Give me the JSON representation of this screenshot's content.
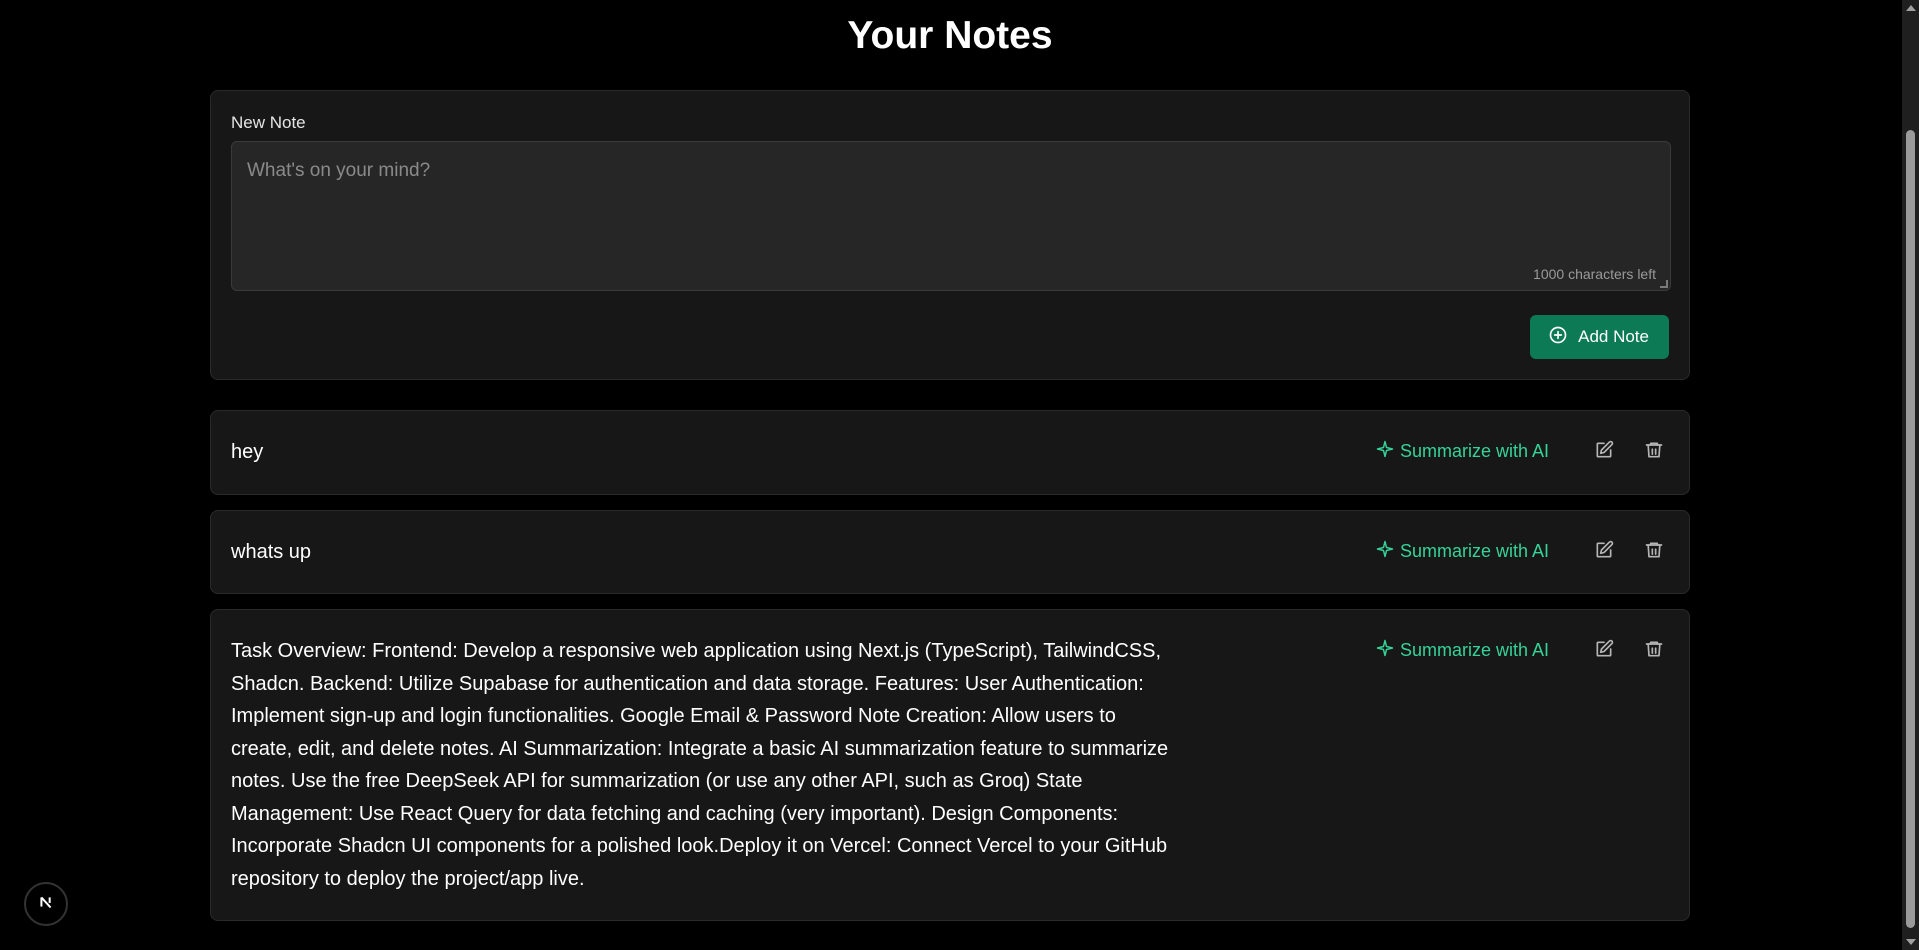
{
  "header": {
    "title": "Your Notes"
  },
  "composer": {
    "label": "New Note",
    "placeholder": "What's on your mind?",
    "value": "",
    "char_count": "1000 characters left",
    "add_button_label": "Add Note",
    "add_button_icon": "plus-circle-icon"
  },
  "notes": [
    {
      "text": "hey",
      "summarize_label": "Summarize with AI"
    },
    {
      "text": "whats up",
      "summarize_label": "Summarize with AI"
    },
    {
      "text": "Task Overview: Frontend: Develop a responsive web application using Next.js (TypeScript), TailwindCSS, Shadcn. Backend: Utilize Supabase for authentication and data storage. Features: User Authentication: Implement sign-up and login functionalities. Google Email & Password Note Creation: Allow users to create, edit, and delete notes. AI Summarization: Integrate a basic AI summarization feature to summarize notes. Use the free DeepSeek API for summarization (or use any other API, such as Groq) State Management: Use React Query for data fetching and caching (very important). Design Components: Incorporate Shadcn UI components for a polished look.Deploy it on Vercel: Connect Vercel to your GitHub repository to deploy the project/app live.",
      "summarize_label": "Summarize with AI"
    }
  ],
  "icons": {
    "summarize": "sparkle-icon",
    "edit": "edit-icon",
    "delete": "trash-icon",
    "dev_badge": "nextjs-logo-icon"
  },
  "colors": {
    "accent": "#0b7a55",
    "summarize_text": "#34d399",
    "background": "#000000",
    "card": "#171717"
  }
}
